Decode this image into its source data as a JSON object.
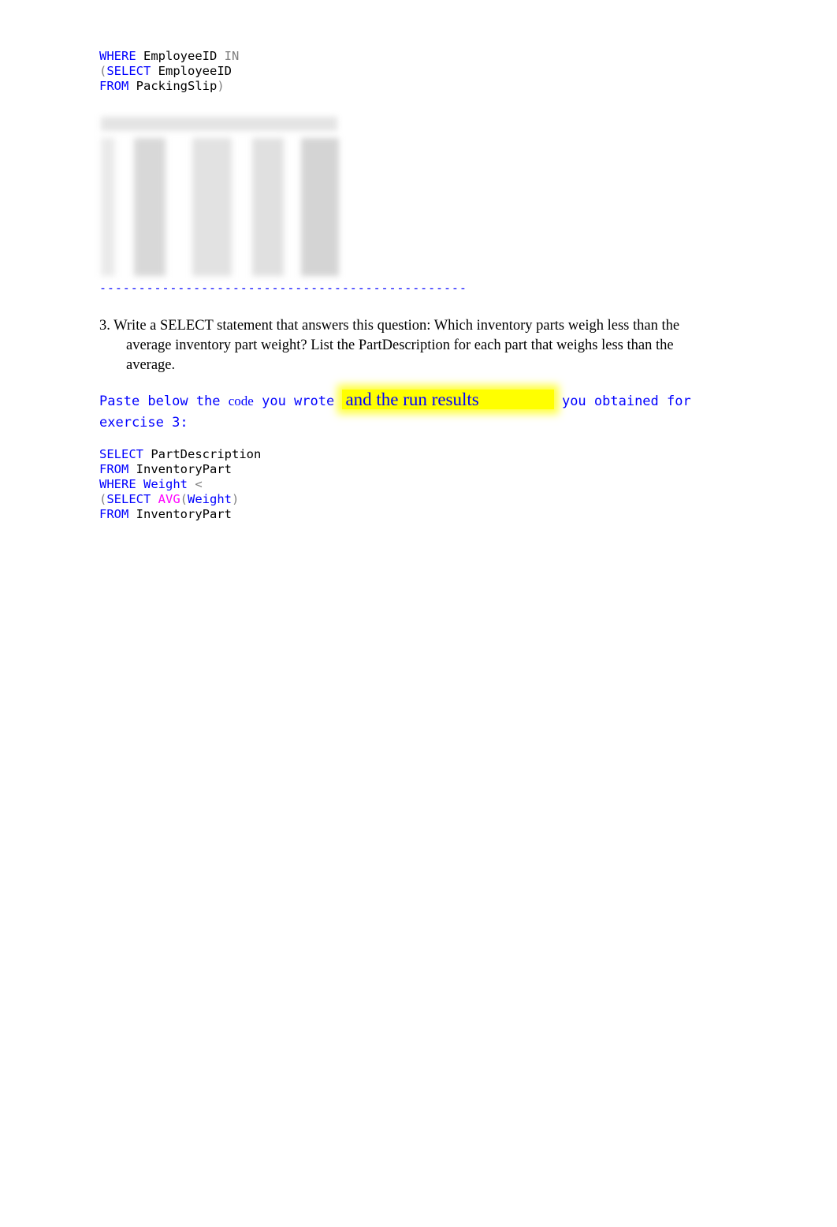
{
  "code_block_1": {
    "line1": {
      "kw": "WHERE",
      "ident": " EmployeeID ",
      "op": "IN"
    },
    "line2": {
      "paren": "(",
      "kw": "SELECT",
      "ident": " EmployeeID"
    },
    "line3": {
      "kw": "FROM",
      "ident": " PackingSlip",
      "paren": ")"
    }
  },
  "separator": "-----------------------------------------------",
  "question": {
    "number": "3.",
    "text_line1": "Write a SELECT statement that answers this question: Which inventory parts weigh less than the",
    "text_rest": "average inventory part weight?   List the PartDescription for each part that weighs less than the average."
  },
  "instruction": {
    "part1": "Paste below the ",
    "code_word": "code",
    "part2": "  you wrote ",
    "highlight": "and the run results",
    "part3": " you obtained for exercise 3:",
    "highlight_color": "#ffff00"
  },
  "code_block_2": {
    "line1": {
      "kw": "SELECT",
      "ident": " PartDescription"
    },
    "line2": {
      "kw": "FROM",
      "ident": " InventoryPart"
    },
    "line3": {
      "kw": "WHERE Weight",
      "op": " <"
    },
    "line4": {
      "paren": "(",
      "kw": "SELECT",
      "fn": " AVG",
      "paren2": "(",
      "kw2": "Weight",
      "paren3": ")"
    },
    "line5": {
      "kw": "FROM",
      "ident": " InventoryPart"
    }
  }
}
